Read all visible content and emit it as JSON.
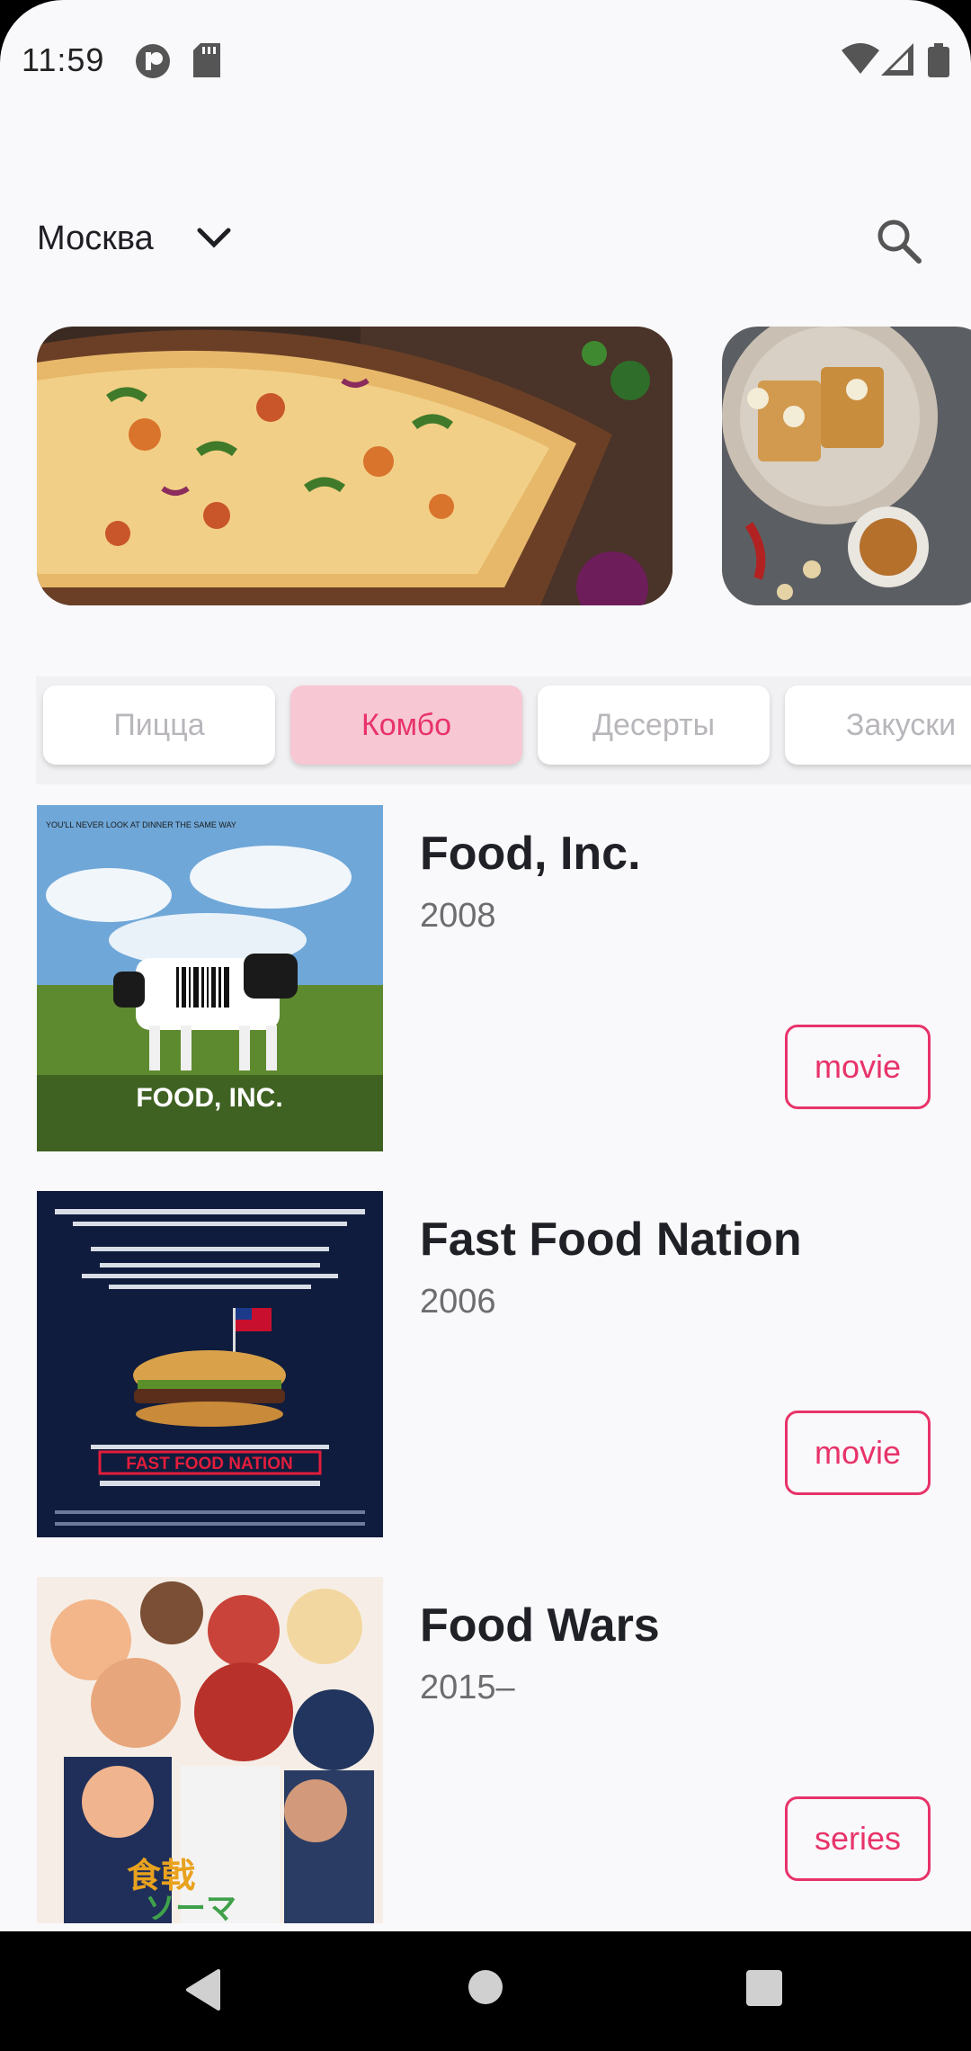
{
  "status_bar": {
    "time": "11:59"
  },
  "header": {
    "city": "Москва"
  },
  "banners": [
    {
      "name": "pizza-banner"
    },
    {
      "name": "food-banner"
    }
  ],
  "tabs": [
    {
      "label": "Пицца",
      "active": false
    },
    {
      "label": "Комбо",
      "active": true
    },
    {
      "label": "Десерты",
      "active": false
    },
    {
      "label": "Закуски",
      "active": false
    }
  ],
  "items": [
    {
      "title": "Food, Inc.",
      "year": "2008",
      "type": "movie",
      "poster_caption": "FOOD, INC."
    },
    {
      "title": "Fast Food Nation",
      "year": "2006",
      "type": "movie",
      "poster_caption": "FAST FOOD NATION"
    },
    {
      "title": "Food Wars",
      "year": "2015–",
      "type": "series"
    }
  ],
  "colors": {
    "accent": "#e8336a",
    "tab_active_bg": "#f7c7d3",
    "background": "#f9f8fa"
  }
}
